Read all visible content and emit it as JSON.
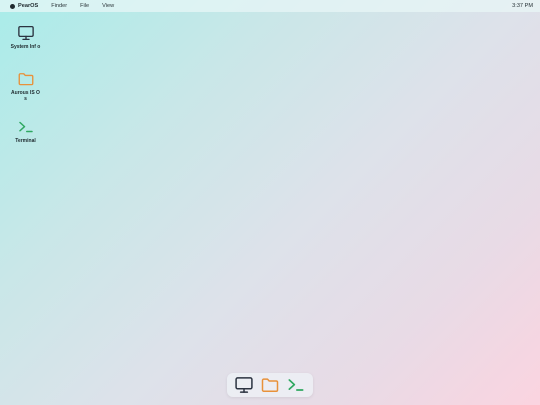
{
  "menubar": {
    "brand": "PearOS",
    "menus": [
      "Finder",
      "File",
      "View"
    ],
    "clock": "3:37 PM"
  },
  "desktop": {
    "icons": [
      {
        "label": "System Inf o",
        "icon": "monitor-icon",
        "color": "#2b3340"
      },
      {
        "label": "Aurous IS Os",
        "icon": "folder-icon",
        "color": "#e8913a"
      },
      {
        "label": "Terminal",
        "icon": "terminal-icon",
        "color": "#2fa860"
      }
    ]
  },
  "dock": {
    "items": [
      {
        "icon": "monitor-icon",
        "color": "#2b3340"
      },
      {
        "icon": "folder-icon",
        "color": "#e8913a"
      },
      {
        "icon": "terminal-icon",
        "color": "#2fa860"
      }
    ]
  }
}
